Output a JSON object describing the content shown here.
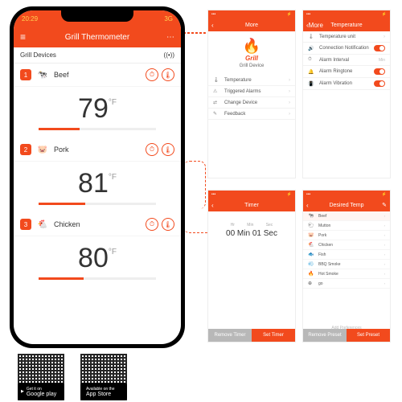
{
  "main": {
    "time": "20:29",
    "carrier": "3G",
    "title": "Grill Thermometer",
    "section": "Grill Devices",
    "signal": "((•))",
    "devices": [
      {
        "n": "1",
        "icon": "🐄",
        "name": "Beef",
        "temp": "79",
        "unit": "°F",
        "fill": "35%"
      },
      {
        "n": "2",
        "icon": "🐷",
        "name": "Pork",
        "temp": "81",
        "unit": "°F",
        "fill": "40%"
      },
      {
        "n": "3",
        "icon": "🐔",
        "name": "Chicken",
        "temp": "80",
        "unit": "°F",
        "fill": "38%"
      }
    ]
  },
  "more": {
    "title": "More",
    "logo": "Grill",
    "device": "Grill Device",
    "items": [
      {
        "ic": "🌡",
        "lbl": "Temperature"
      },
      {
        "ic": "⚠",
        "lbl": "Triggered Alarms"
      },
      {
        "ic": "⇄",
        "lbl": "Change Device"
      },
      {
        "ic": "✎",
        "lbl": "Feedback"
      }
    ]
  },
  "tempset": {
    "title": "Temperature",
    "back": "More",
    "items": [
      {
        "ic": "🌡",
        "lbl": "Temperature unit",
        "ctl": "chev"
      },
      {
        "ic": "🔊",
        "lbl": "Connection Notification",
        "ctl": "toggle"
      },
      {
        "ic": "⏱",
        "lbl": "Alarm Interval",
        "ctl": "val",
        "val": "Min"
      },
      {
        "ic": "🔔",
        "lbl": "Alarm Ringtone",
        "ctl": "toggle"
      },
      {
        "ic": "📳",
        "lbl": "Alarm Vibration",
        "ctl": "toggle"
      }
    ]
  },
  "timer": {
    "title": "Timer",
    "hrlbl": "Hr",
    "minlbl": "Min",
    "seclbl": "Sec",
    "val": "00 Min  01 Sec",
    "b1": "Remove Timer",
    "b2": "Set Timer"
  },
  "preset": {
    "title": "Desired Temp",
    "sel": "Beef",
    "items": [
      {
        "ic": "🐄",
        "n": "Beef"
      },
      {
        "ic": "🐑",
        "n": "Mutton"
      },
      {
        "ic": "🐷",
        "n": "Pork"
      },
      {
        "ic": "🐔",
        "n": "Chicken"
      },
      {
        "ic": "🐟",
        "n": "Fish"
      },
      {
        "ic": "💨",
        "n": "BBQ Smoke"
      },
      {
        "ic": "🔥",
        "n": "Hot Smoke"
      },
      {
        "ic": "⊕",
        "n": "go"
      }
    ],
    "b1": "Remove Preset",
    "b2": "Set Preset",
    "add": "Add Preferences"
  },
  "stores": {
    "gp1": "Get it on",
    "gp2": "Google play",
    "as1": "Available on the",
    "as2": "App Store"
  }
}
